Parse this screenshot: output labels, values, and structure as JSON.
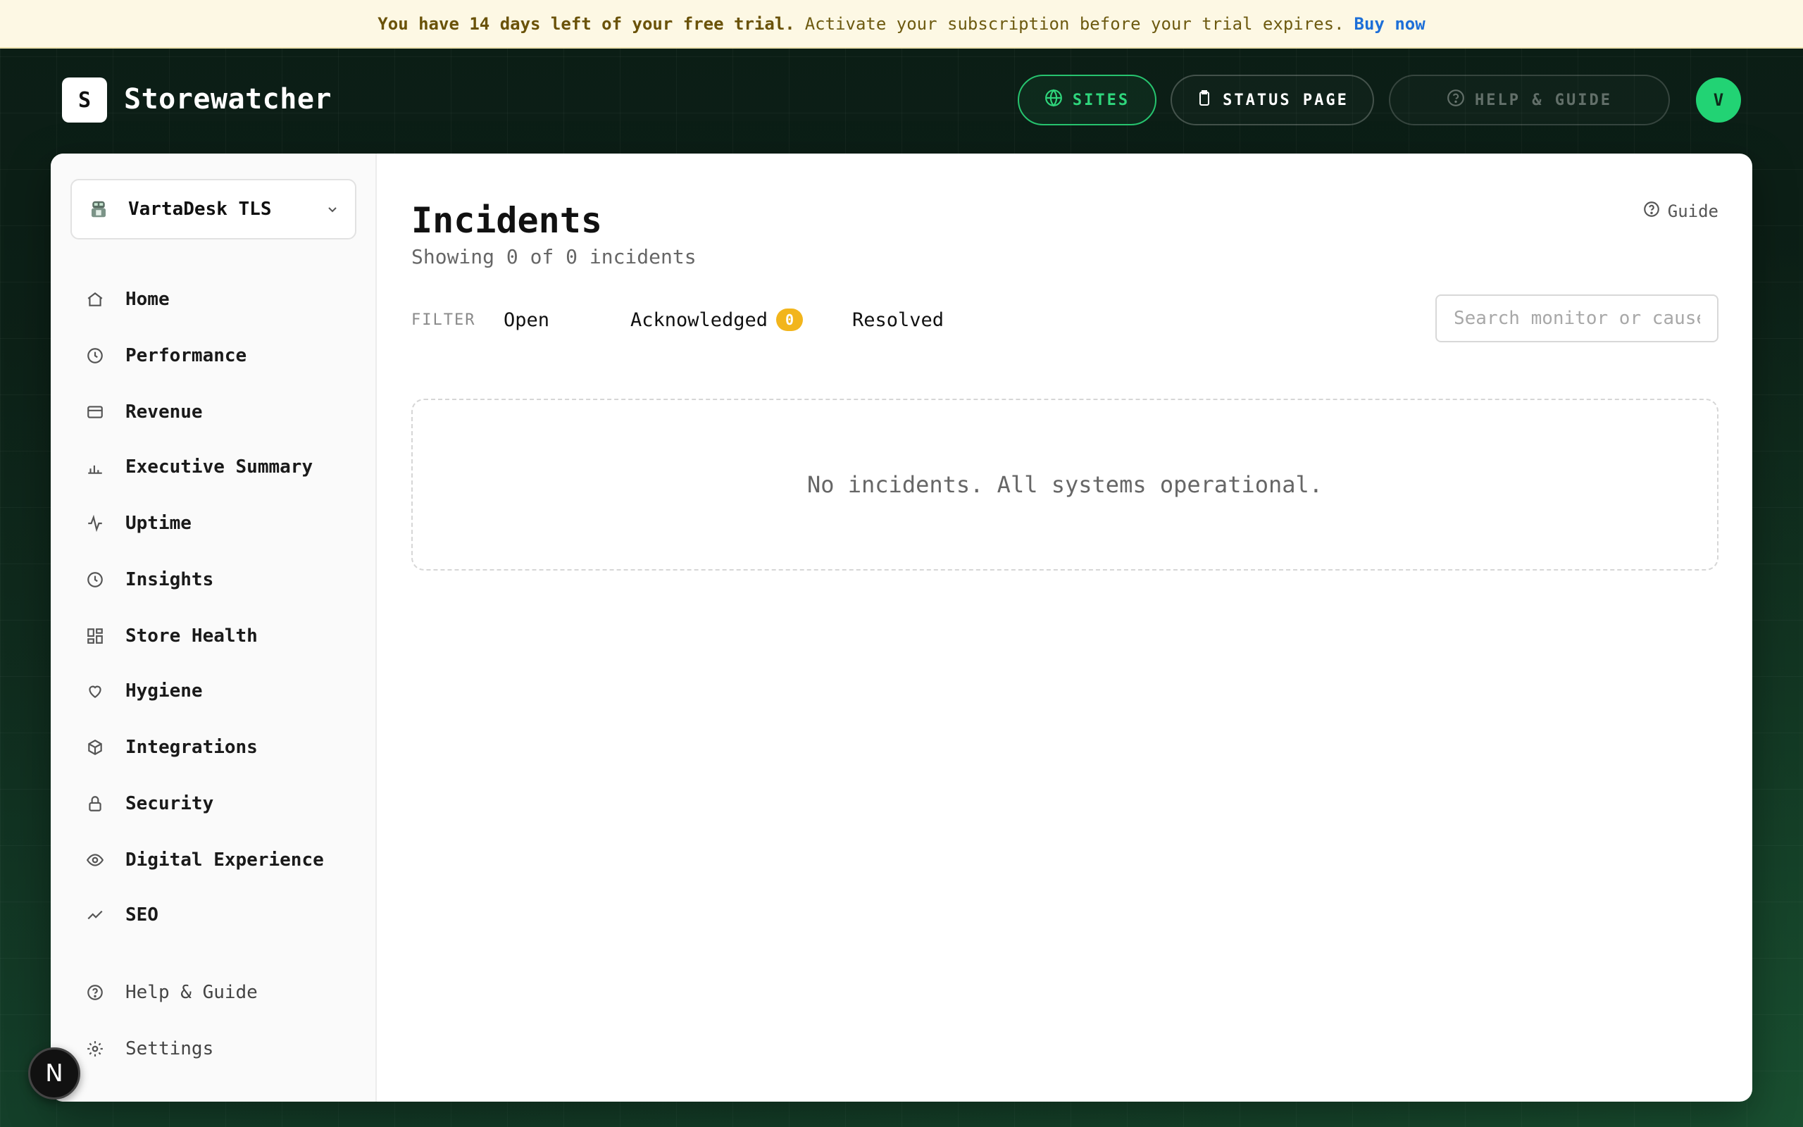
{
  "banner": {
    "strong": "You have 14 days left of your free trial.",
    "text": "Activate your subscription before your trial expires.",
    "link": "Buy now"
  },
  "header": {
    "logo_letter": "S",
    "brand": "Storewatcher",
    "sites_label": "SITES",
    "status_label": "STATUS PAGE",
    "help_label": "HELP & GUIDE",
    "avatar_letter": "V"
  },
  "sidebar": {
    "site_name": "VartaDesk TLS",
    "items": [
      {
        "label": "Home",
        "icon": "home-icon"
      },
      {
        "label": "Performance",
        "icon": "clock-icon"
      },
      {
        "label": "Revenue",
        "icon": "credit-card-icon"
      },
      {
        "label": "Executive Summary",
        "icon": "bar-chart-icon"
      },
      {
        "label": "Uptime",
        "icon": "activity-icon"
      },
      {
        "label": "Insights",
        "icon": "clock-icon"
      },
      {
        "label": "Store Health",
        "icon": "dashboard-icon"
      },
      {
        "label": "Hygiene",
        "icon": "heart-icon"
      },
      {
        "label": "Integrations",
        "icon": "cube-icon"
      },
      {
        "label": "Security",
        "icon": "lock-icon"
      },
      {
        "label": "Digital Experience",
        "icon": "eye-icon"
      },
      {
        "label": "SEO",
        "icon": "trend-icon"
      }
    ],
    "footer": [
      {
        "label": "Help & Guide",
        "icon": "help-circle-icon"
      },
      {
        "label": "Settings",
        "icon": "gear-icon"
      }
    ]
  },
  "main": {
    "title": "Incidents",
    "subtitle": "Showing 0 of 0 incidents",
    "guide_label": "Guide",
    "filter_label": "FILTER",
    "filters": {
      "open": "Open",
      "acknowledged": "Acknowledged",
      "acknowledged_count": "0",
      "resolved": "Resolved"
    },
    "search_placeholder": "Search monitor or cause",
    "empty_message": "No incidents. All systems operational."
  },
  "dev_badge": "N"
}
